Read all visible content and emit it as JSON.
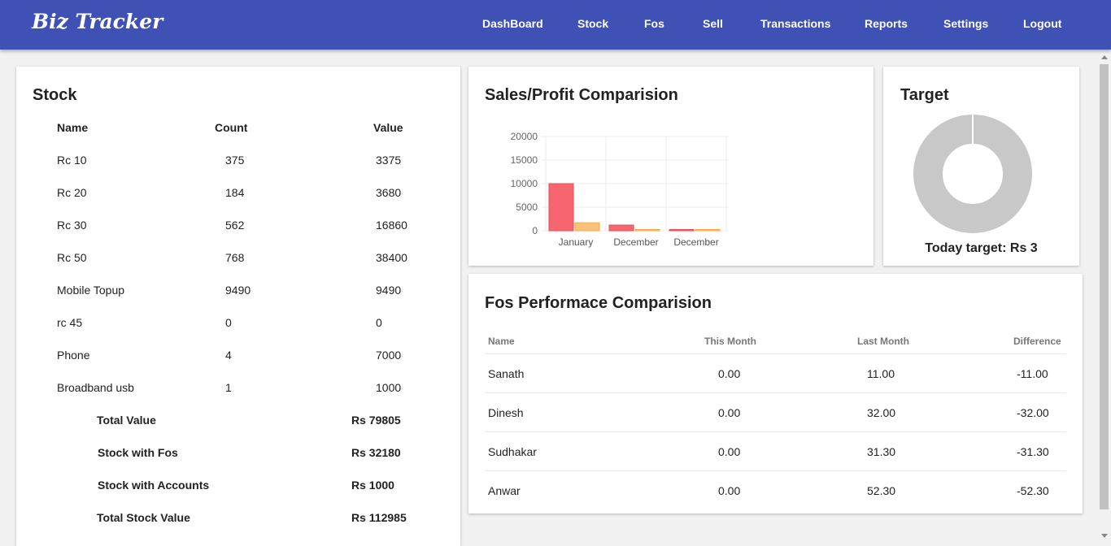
{
  "brand": "Biz Tracker",
  "nav": [
    "DashBoard",
    "Stock",
    "Fos",
    "Sell",
    "Transactions",
    "Reports",
    "Settings",
    "Logout"
  ],
  "stock": {
    "title": "Stock",
    "headers": [
      "Name",
      "Count",
      "Value"
    ],
    "rows": [
      [
        "Rc 10",
        "375",
        "3375"
      ],
      [
        "Rc 20",
        "184",
        "3680"
      ],
      [
        "Rc 30",
        "562",
        "16860"
      ],
      [
        "Rc 50",
        "768",
        "38400"
      ],
      [
        "Mobile Topup",
        "9490",
        "9490"
      ],
      [
        "rc 45",
        "0",
        "0"
      ],
      [
        "Phone",
        "4",
        "7000"
      ],
      [
        "Broadband usb",
        "1",
        "1000"
      ]
    ],
    "totals": [
      [
        "Total Value",
        "Rs 79805"
      ],
      [
        "Stock with Fos",
        "Rs 32180"
      ],
      [
        "Stock with Accounts",
        "Rs 1000"
      ],
      [
        "Total Stock Value",
        "Rs 112985"
      ]
    ]
  },
  "sales": {
    "title": "Sales/Profit Comparision",
    "chart_data": {
      "type": "bar",
      "categories": [
        "January",
        "December",
        "December"
      ],
      "series": [
        {
          "values": [
            10000,
            1200,
            200
          ],
          "color": "#f7666e"
        },
        {
          "values": [
            1700,
            150,
            100
          ],
          "color": "#f9c27a"
        }
      ],
      "ylim": [
        0,
        20000
      ],
      "yticks": [
        "20000",
        "15000",
        "10000",
        "5000",
        "0"
      ],
      "grid": true
    }
  },
  "target": {
    "title": "Target",
    "label": "Today target: Rs 3",
    "donut_color": "#c8c8c8"
  },
  "fos": {
    "title": "Fos Performace Comparision",
    "headers": [
      "Name",
      "This Month",
      "Last Month",
      "Difference"
    ],
    "rows": [
      [
        "Sanath",
        "0.00",
        "11.00",
        "-11.00"
      ],
      [
        "Dinesh",
        "0.00",
        "32.00",
        "-32.00"
      ],
      [
        "Sudhakar",
        "0.00",
        "31.30",
        "-31.30"
      ],
      [
        "Anwar",
        "0.00",
        "52.30",
        "-52.30"
      ]
    ]
  }
}
